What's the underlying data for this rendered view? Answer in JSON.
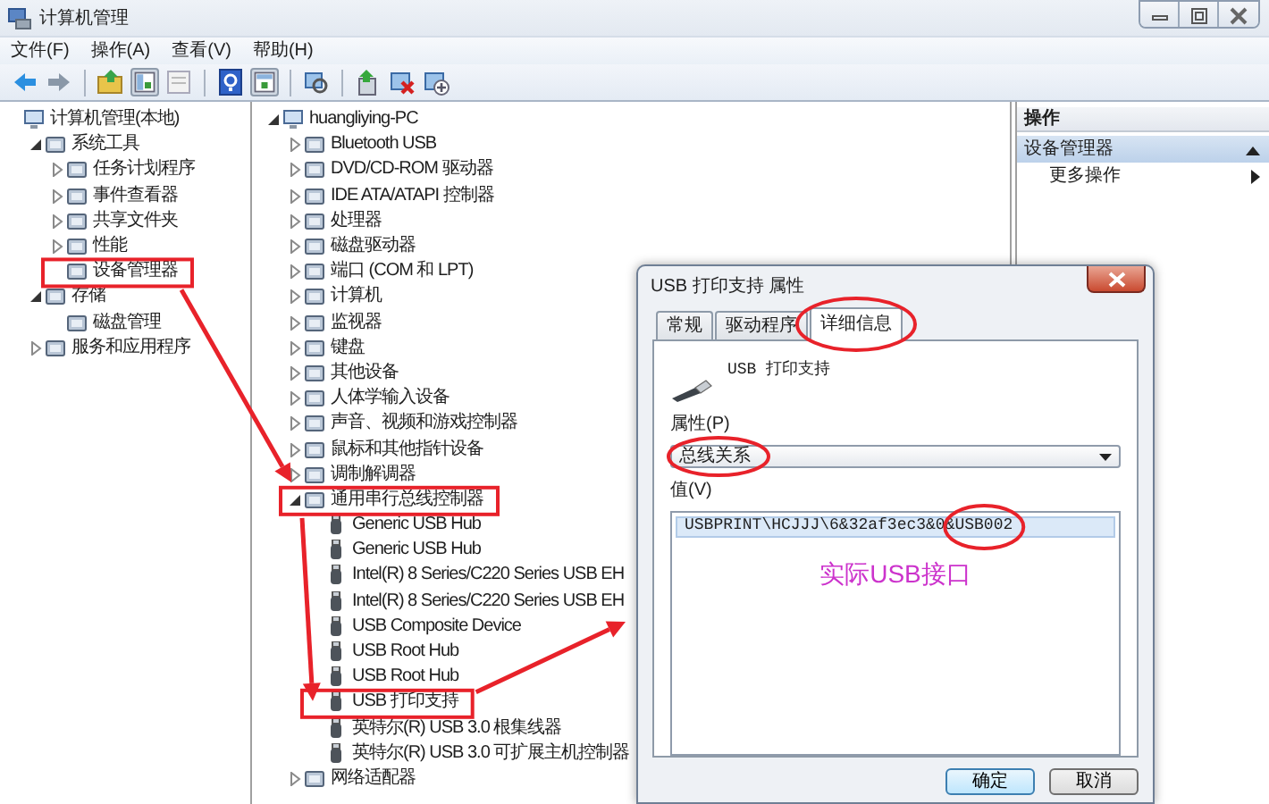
{
  "window": {
    "title": "计算机管理"
  },
  "menu": [
    "文件(F)",
    "操作(A)",
    "查看(V)",
    "帮助(H)"
  ],
  "left_tree": [
    {
      "label": "计算机管理(本地)",
      "children": [
        {
          "label": "系统工具",
          "expanded": true,
          "children": [
            {
              "label": "任务计划程序",
              "expanded": false,
              "marked": false
            },
            {
              "label": "事件查看器",
              "expanded": false,
              "marked": false
            },
            {
              "label": "共享文件夹",
              "expanded": false,
              "marked": false
            },
            {
              "label": "性能",
              "expanded": false,
              "marked": false
            },
            {
              "label": "设备管理器",
              "marked": true
            }
          ]
        },
        {
          "label": "存储",
          "expanded": true,
          "children": [
            {
              "label": "磁盘管理"
            }
          ]
        },
        {
          "label": "服务和应用程序",
          "expanded": false
        }
      ]
    }
  ],
  "device_tree": [
    {
      "label": "huangliying-PC",
      "expanded": true,
      "children": [
        {
          "label": "Bluetooth USB",
          "expanded": false,
          "marked": false
        },
        {
          "label": "DVD/CD-ROM 驱动器",
          "expanded": false,
          "marked": false
        },
        {
          "label": "IDE ATA/ATAPI 控制器",
          "expanded": false,
          "marked": false
        },
        {
          "label": "处理器",
          "expanded": false,
          "marked": false
        },
        {
          "label": "磁盘驱动器",
          "expanded": false,
          "marked": false
        },
        {
          "label": "端口 (COM 和 LPT)",
          "expanded": false,
          "marked": false
        },
        {
          "label": "计算机",
          "expanded": false,
          "marked": false
        },
        {
          "label": "监视器",
          "expanded": false,
          "marked": false
        },
        {
          "label": "键盘",
          "expanded": false,
          "marked": false
        },
        {
          "label": "其他设备",
          "expanded": false,
          "marked": false
        },
        {
          "label": "人体学输入设备",
          "expanded": false,
          "marked": false
        },
        {
          "label": "声音、视频和游戏控制器",
          "expanded": false,
          "marked": false
        },
        {
          "label": "鼠标和其他指针设备",
          "expanded": false,
          "marked": false
        },
        {
          "label": "调制解调器",
          "expanded": false,
          "marked": false
        },
        {
          "label": "通用串行总线控制器",
          "expanded": true,
          "marked": true,
          "children": [
            {
              "label": "Generic USB Hub",
              "marked": false
            },
            {
              "label": "Generic USB Hub",
              "marked": false
            },
            {
              "label": "Intel(R) 8 Series/C220 Series USB EH",
              "marked": false
            },
            {
              "label": "Intel(R) 8 Series/C220 Series USB EH",
              "marked": false
            },
            {
              "label": "USB Composite Device",
              "marked": false
            },
            {
              "label": "USB Root Hub",
              "marked": false
            },
            {
              "label": "USB Root Hub",
              "marked": false
            },
            {
              "label": "USB 打印支持",
              "marked": true
            },
            {
              "label": "英特尔(R) USB 3.0 根集线器",
              "marked": false
            },
            {
              "label": "英特尔(R) USB 3.0 可扩展主机控制器",
              "marked": false
            }
          ]
        },
        {
          "label": "网络适配器",
          "expanded": false,
          "marked": false
        }
      ]
    }
  ],
  "actions": {
    "header": "操作",
    "groups": [
      {
        "title": "设备管理器",
        "expanded": true,
        "items": [
          {
            "label": "更多操作"
          }
        ]
      }
    ]
  },
  "dialog": {
    "title": "USB 打印支持 属性",
    "tabs": [
      {
        "label": "常规",
        "selected": false,
        "circled": false
      },
      {
        "label": "驱动程序",
        "selected": false,
        "circled": false
      },
      {
        "label": "详细信息",
        "selected": true,
        "circled": true
      }
    ],
    "device_name": "USB 打印支持",
    "property_label": "属性(P)",
    "property": {
      "value": "总线关系",
      "circled": true
    },
    "value_label": "值(V)",
    "values": [
      {
        "text": "USBPRINT\\HCJJJ\\6&32af3ec3&0&USB002",
        "selected": true,
        "circled": true
      }
    ],
    "note": "实际USB接口",
    "buttons": [
      {
        "label": "确定",
        "default": true
      },
      {
        "label": "取消",
        "default": false
      }
    ]
  }
}
